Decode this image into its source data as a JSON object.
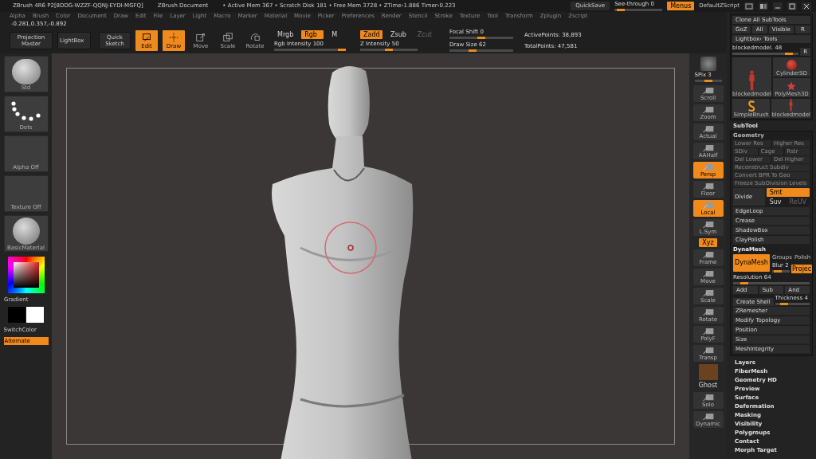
{
  "title_bar": {
    "app": "ZBrush 4R6 P2[8DDG-WZZF-QQNJ-EYDI-MGFQ]",
    "document": "ZBrush Document",
    "stats": "• Active Mem 367 • Scratch Disk 181 • Free Mem 3728 • ZTime›1.886 Timer›0.223"
  },
  "top_right": {
    "quicksave": "QuickSave",
    "see_through": {
      "label": "See-through 0",
      "level": 0.05
    },
    "menus": {
      "label": "Menus",
      "selected": true
    },
    "script": "DefaultZScript"
  },
  "menu": [
    "Alpha",
    "Brush",
    "Color",
    "Document",
    "Draw",
    "Edit",
    "File",
    "Layer",
    "Light",
    "Macro",
    "Marker",
    "Material",
    "Movie",
    "Picker",
    "Preferences",
    "Render",
    "Stencil",
    "Stroke",
    "Texture",
    "Tool",
    "Transform",
    "Zplugin",
    "Zscript"
  ],
  "coordinates": "-0.281,0.357,-0.892",
  "toolbar": {
    "projection_master": "Projection Master",
    "lightbox": "LightBox",
    "quick_sketch": "Quick Sketch",
    "modes": [
      {
        "label": "Edit",
        "selected": true
      },
      {
        "label": "Draw",
        "selected": true
      },
      {
        "label": "Move",
        "selected": false
      },
      {
        "label": "Scale",
        "selected": false
      },
      {
        "label": "Rotate",
        "selected": false
      }
    ],
    "color_modes": [
      {
        "label": "Mrgb",
        "selected": false
      },
      {
        "label": "Rgb",
        "selected": true
      },
      {
        "label": "M",
        "selected": false
      }
    ],
    "depth_modes": [
      {
        "label": "Zadd",
        "selected": true,
        "disabled": false
      },
      {
        "label": "Zsub",
        "selected": false,
        "disabled": false
      },
      {
        "label": "Zcut",
        "selected": false,
        "disabled": true
      }
    ],
    "sliders": [
      {
        "label": "Rgb Intensity 100",
        "level": 1.0
      },
      {
        "label": "Z Intensity 50",
        "level": 0.5
      },
      {
        "label": "Focal Shift 0",
        "level": 0.5
      },
      {
        "label": "Draw Size 62",
        "level": 0.35
      }
    ],
    "active_points": "ActivePoints: 38,893",
    "total_points": "TotalPoints: 47,581"
  },
  "left_shelf": {
    "thumbnails": [
      {
        "label": "Std",
        "kind": "brush"
      },
      {
        "label": "Dots",
        "kind": "stroke"
      },
      {
        "label": "Alpha Off",
        "kind": "empty"
      },
      {
        "label": "Texture Off",
        "kind": "empty"
      },
      {
        "label": "BasicMaterial",
        "kind": "sphere"
      }
    ],
    "gradient": "Gradient",
    "switch_color": "SwitchColor",
    "alternate": "Alternate"
  },
  "right_shelf": [
    {
      "label": "SPix 3",
      "kind": "slider",
      "level": 0.5
    },
    {
      "label": "Scroll",
      "kind": "button",
      "selected": false
    },
    {
      "label": "Zoom",
      "kind": "button",
      "selected": false
    },
    {
      "label": "Actual",
      "kind": "button",
      "selected": false
    },
    {
      "label": "AAHalf",
      "kind": "button",
      "selected": false
    },
    {
      "label": "Persp",
      "kind": "button",
      "selected": true
    },
    {
      "label": "Floor",
      "kind": "button",
      "selected": false
    },
    {
      "label": "Local",
      "kind": "button",
      "selected": true
    },
    {
      "label": "L.Sym",
      "kind": "button",
      "selected": false
    },
    {
      "label": "Xyz",
      "kind": "small",
      "selected": true
    },
    {
      "label": "Frame",
      "kind": "button",
      "selected": false
    },
    {
      "label": "Move",
      "kind": "button",
      "selected": false
    },
    {
      "label": "Scale",
      "kind": "button",
      "selected": false
    },
    {
      "label": "Rotate",
      "kind": "button",
      "selected": false
    },
    {
      "label": "PolyF",
      "kind": "button",
      "selected": false
    },
    {
      "label": "Transp",
      "kind": "button",
      "selected": false
    },
    {
      "label": "Ghost",
      "kind": "swatch",
      "selected": false
    },
    {
      "label": "Solo",
      "kind": "button",
      "selected": false
    },
    {
      "label": "Dynamic",
      "kind": "button",
      "selected": false
    }
  ],
  "tool_panel": {
    "clone": "Clone All SubTools",
    "buttons": [
      "GoZ",
      "All",
      "Visible",
      "R"
    ],
    "lightbox_tools": "Lightbox› Tools",
    "current_tool": {
      "label": "blockedmodel. 48",
      "level": 0.9
    },
    "reset": "R",
    "main_tool": {
      "label": "blockedmodel",
      "kind": "figure"
    },
    "tools": [
      {
        "label": "CylinderSD",
        "kind": "cylinder"
      },
      {
        "label": "PolyMesh3D",
        "kind": "star"
      },
      {
        "label": "SimpleBrush",
        "kind": "brush"
      },
      {
        "label": "blockedmodel",
        "kind": "figure"
      }
    ]
  },
  "subtool": "SubTool",
  "geometry": {
    "title": "Geometry",
    "expanded": true,
    "disabled_rows": [
      [
        "Lower Res",
        "Higher Res"
      ],
      [
        "SDiv",
        "Cage",
        "Rstr"
      ],
      [
        "Del Lower",
        "Del Higher"
      ],
      [
        "Reconstruct Subdiv"
      ],
      [
        "Convert BPR To Geo"
      ],
      [
        "Freeze SubDivision Levels"
      ]
    ],
    "divide": "Divide",
    "smt": {
      "label": "Smt",
      "selected": true
    },
    "suv": "Suv",
    "reuv": "ReUV",
    "items": [
      "EdgeLoop",
      "Crease",
      "ShadowBox",
      "ClayPolish"
    ],
    "dynamesh": {
      "title": "DynaMesh",
      "button": {
        "label": "DynaMesh",
        "selected": true
      },
      "groups": "Groups",
      "polish": "Polish",
      "blur": {
        "label": "Blur 2",
        "level": 0.2
      },
      "project": {
        "label": "Projec",
        "selected": true
      },
      "resolution": {
        "label": "Resolution 64",
        "level": 0.1
      },
      "add": "Add",
      "sub": "Sub",
      "and": "And",
      "create_shell": "Create Shell",
      "thickness": {
        "label": "Thickness 4",
        "level": 0.2
      }
    },
    "items_after": [
      "ZRemesher",
      "Modify Topology",
      "Position",
      "Size",
      "MeshIntegrity"
    ]
  },
  "sections": [
    "Layers",
    "FiberMesh",
    "Geometry HD",
    "Preview",
    "Surface",
    "Deformation",
    "Masking",
    "Visibility",
    "Polygroups",
    "Contact",
    "Morph Target"
  ]
}
